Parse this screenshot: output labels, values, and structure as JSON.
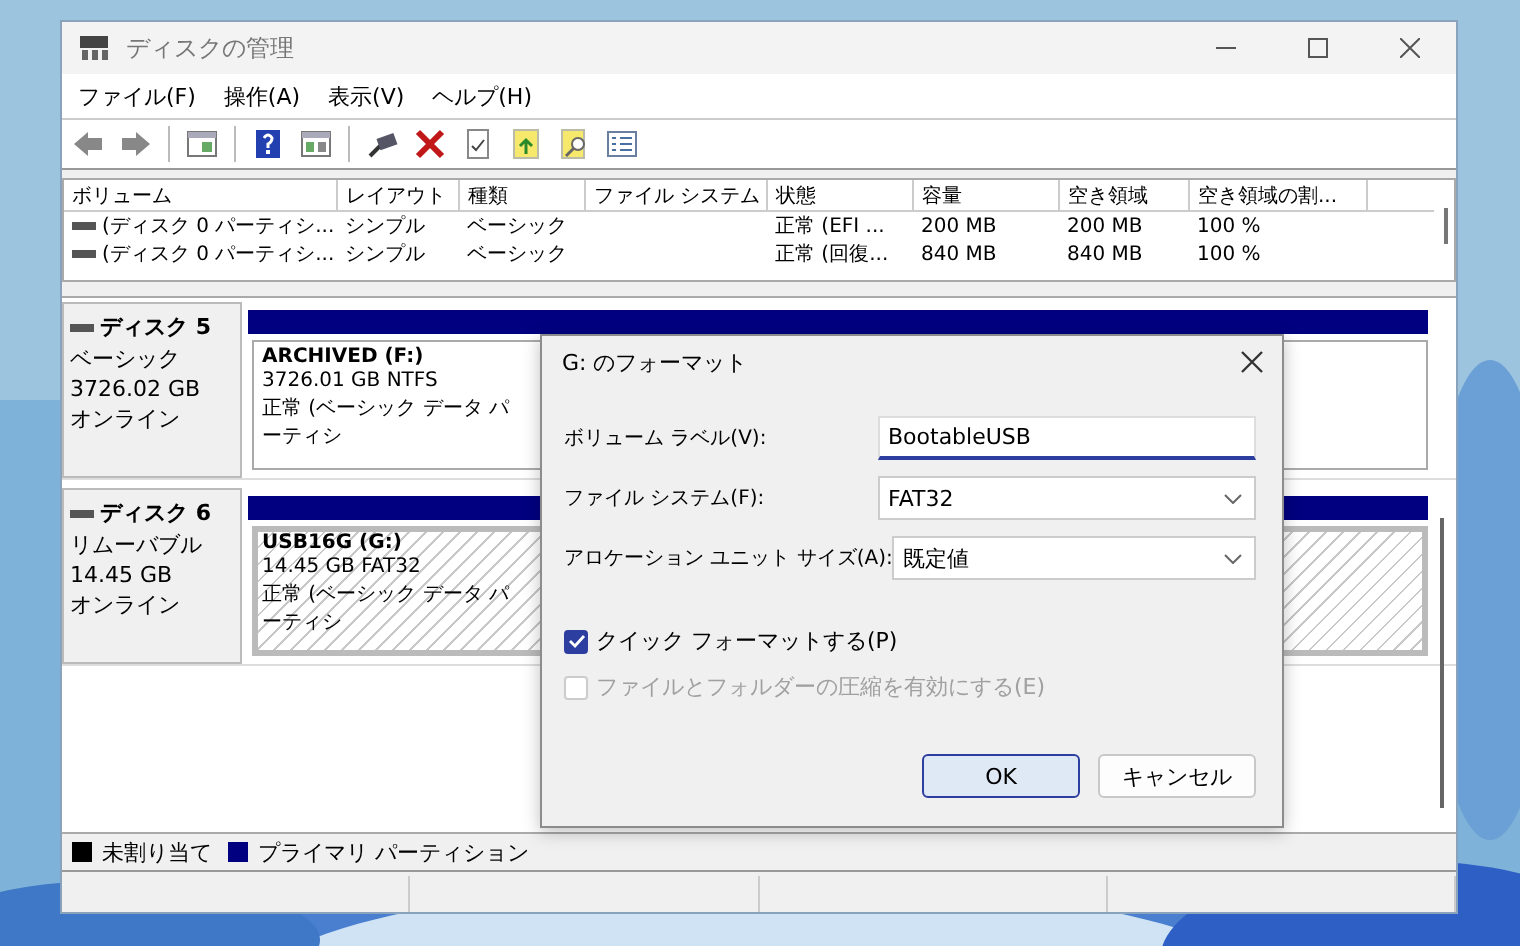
{
  "window": {
    "title": "ディスクの管理"
  },
  "menu": [
    "ファイル(F)",
    "操作(A)",
    "表示(V)",
    "ヘルプ(H)"
  ],
  "volumes": {
    "columns": [
      "ボリューム",
      "レイアウト",
      "種類",
      "ファイル システム",
      "状態",
      "容量",
      "空き領域",
      "空き領域の割..."
    ],
    "rows": [
      {
        "cells": [
          "(ディスク 0 パーティシ...",
          "シンプル",
          "ベーシック",
          "",
          "正常 (EFI ...",
          "200 MB",
          "200 MB",
          "100 %"
        ]
      },
      {
        "cells": [
          "(ディスク 0 パーティシ...",
          "シンプル",
          "ベーシック",
          "",
          "正常 (回復...",
          "840 MB",
          "840 MB",
          "100 %"
        ]
      }
    ]
  },
  "disks": [
    {
      "name": "ディスク 5",
      "type": "ベーシック",
      "size": "3726.02 GB",
      "status": "オンライン",
      "partitions": [
        {
          "label": "ARCHIVED  (F:)",
          "detail": "3726.01 GB NTFS",
          "status": "正常 (ベーシック データ パーティシ",
          "selected": false
        }
      ]
    },
    {
      "name": "ディスク 6",
      "type": "リムーバブル",
      "size": "14.45 GB",
      "status": "オンライン",
      "partitions": [
        {
          "label": "USB16G  (G:)",
          "detail": "14.45 GB FAT32",
          "status": "正常 (ベーシック データ パーティシ",
          "selected": true
        }
      ]
    }
  ],
  "legend": [
    {
      "label": "未割り当て",
      "color": "#000000"
    },
    {
      "label": "プライマリ パーティション",
      "color": "#000080"
    }
  ],
  "dialog": {
    "title": "G: のフォーマット",
    "fields": [
      {
        "kind": "text",
        "label": "ボリューム ラベル(V):",
        "value": "BootableUSB",
        "focused": true
      },
      {
        "kind": "select",
        "label": "ファイル システム(F):",
        "value": "FAT32"
      },
      {
        "kind": "select",
        "label": "アロケーション ユニット サイズ(A):",
        "value": "既定値"
      }
    ],
    "checkboxes": [
      {
        "label": "クイック フォーマットする(P)",
        "checked": true,
        "disabled": false
      },
      {
        "label": "ファイルとフォルダーの圧縮を有効にする(E)",
        "checked": false,
        "disabled": true
      }
    ],
    "buttons": [
      {
        "label": "OK",
        "default": true
      },
      {
        "label": "キャンセル",
        "default": false
      }
    ]
  }
}
